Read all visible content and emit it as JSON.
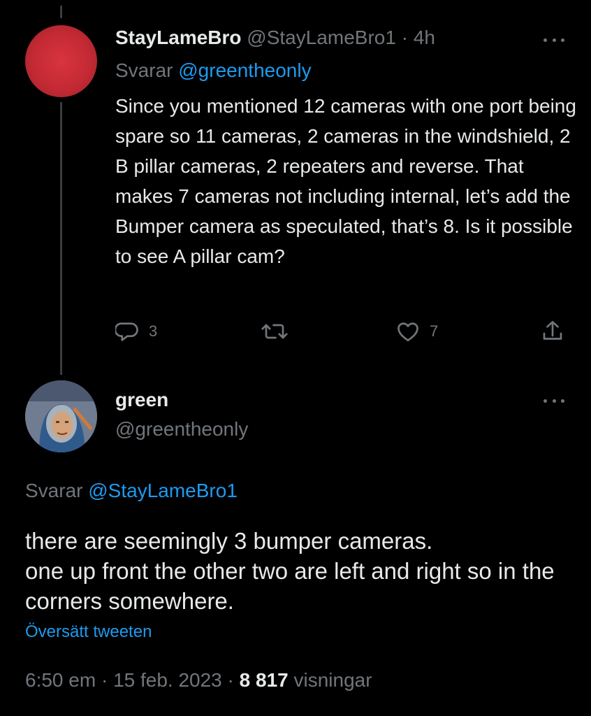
{
  "tweet1": {
    "display_name": "StayLameBro",
    "handle": "@StayLameBro1",
    "separator": " · ",
    "time": "4h",
    "replying_prefix": "Svarar ",
    "replying_to": "@greentheonly",
    "text": "Since you mentioned 12 cameras with one port being spare so 11 cameras, 2 cameras in the windshield, 2 B pillar cameras, 2 repeaters and reverse. That makes 7 cameras not including internal, let’s add the Bumper camera as speculated, that’s 8. Is it possible to see A pillar cam?",
    "reply_count": "3",
    "retweet_count": "",
    "like_count": "7",
    "avatar_color": "#d8343f"
  },
  "tweet2": {
    "display_name": "green",
    "handle": "@greentheonly",
    "replying_prefix": "Svarar ",
    "replying_to": "@StayLameBro1",
    "text": "there are seemingly 3 bumper cameras.\none up front the other two are left and right so in the corners somewhere.",
    "translate_label": "Översätt tweeten",
    "time": "6:50 em",
    "sep1": " · ",
    "date": "15 feb. 2023",
    "sep2": " · ",
    "views_count": "8 817",
    "views_label": " visningar"
  },
  "icons": {
    "reply": "reply-icon",
    "retweet": "retweet-icon",
    "like": "heart-icon",
    "share": "share-icon",
    "more": "more-icon"
  },
  "colors": {
    "background": "#000000",
    "text": "#e7e9ea",
    "muted": "#71767b",
    "link": "#1d9bf0"
  }
}
